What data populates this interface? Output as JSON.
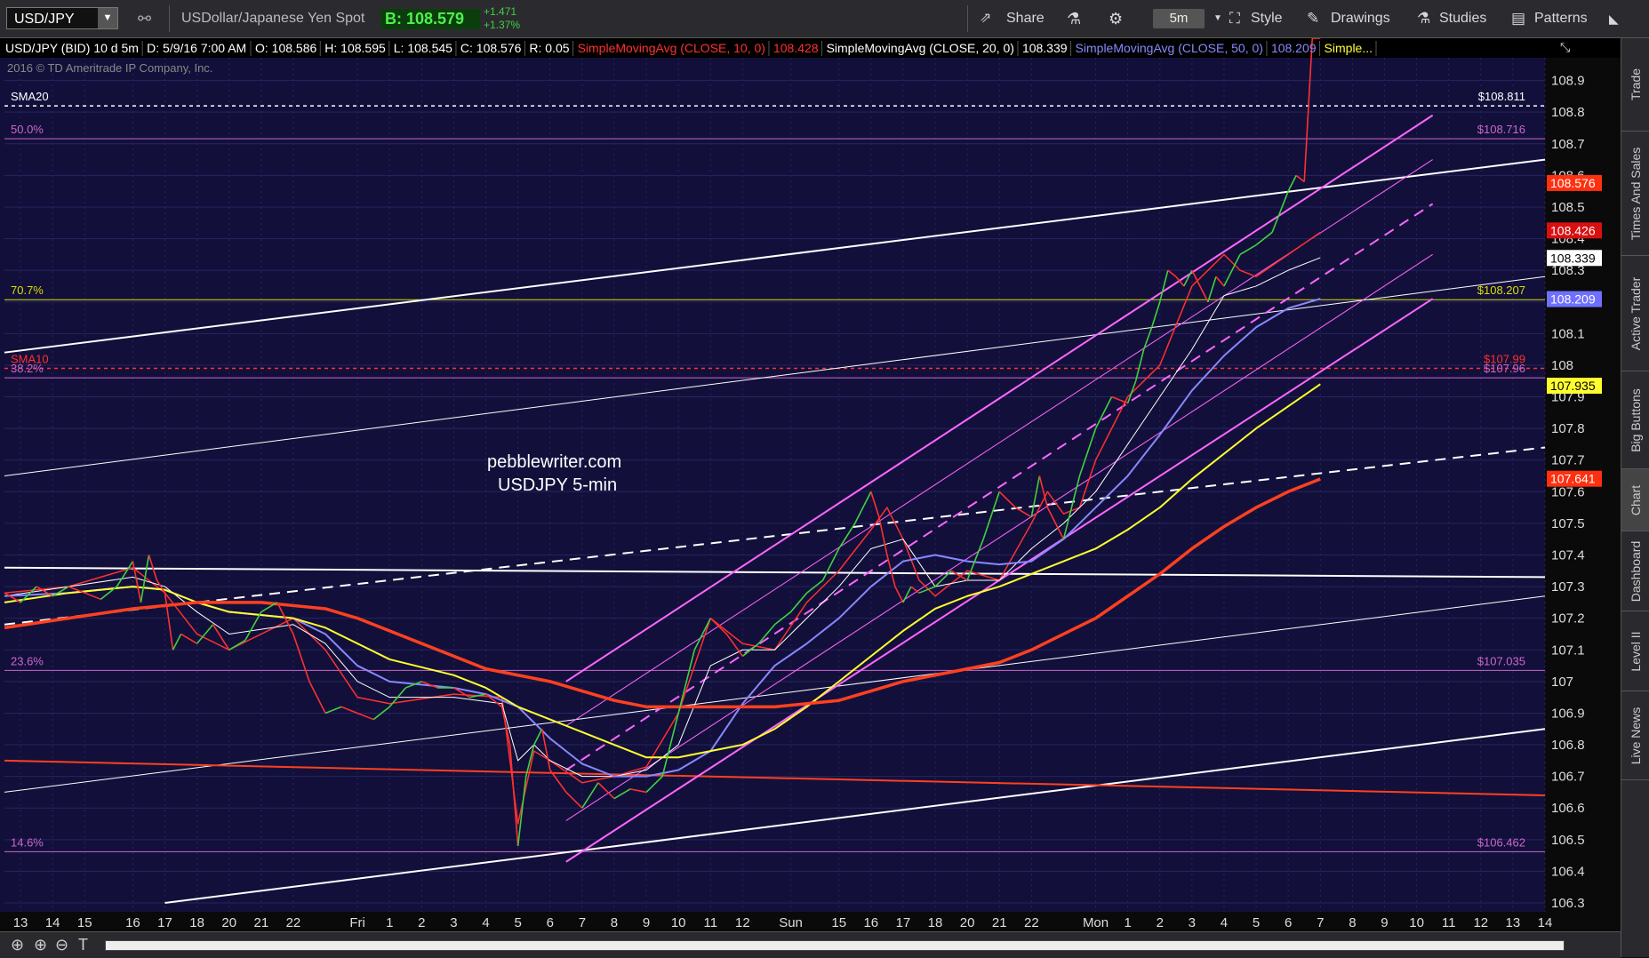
{
  "toolbar": {
    "symbol": "USD/JPY",
    "description": "USDollar/Japanese Yen Spot",
    "bid": "B: 108.579",
    "change_abs": "+1.471",
    "change_pct": "+1.37%",
    "share": "Share",
    "timeframe": "5m",
    "style": "Style",
    "drawings": "Drawings",
    "studies": "Studies",
    "patterns": "Patterns"
  },
  "sidebar": [
    "Trade",
    "Times And Sales",
    "Active Trader",
    "Big Buttons",
    "Chart",
    "Dashboard",
    "Level II",
    "Live News"
  ],
  "chart_data": {
    "type": "line",
    "header": [
      {
        "text": "USD/JPY (BID) 10 d 5m",
        "color": "#ffffff"
      },
      {
        "text": "D: 5/9/16 7:00 AM",
        "color": "#ffffff"
      },
      {
        "text": "O: 108.586",
        "color": "#ffffff"
      },
      {
        "text": "H: 108.595",
        "color": "#ffffff"
      },
      {
        "text": "L: 108.545",
        "color": "#ffffff"
      },
      {
        "text": "C: 108.576",
        "color": "#ffffff"
      },
      {
        "text": "R: 0.05",
        "color": "#ffffff"
      },
      {
        "text": "SimpleMovingAvg (CLOSE, 10, 0)",
        "color": "#ff3030"
      },
      {
        "text": "108.428",
        "color": "#ff3030"
      },
      {
        "text": "SimpleMovingAvg (CLOSE, 20, 0)",
        "color": "#ffffff"
      },
      {
        "text": "108.339",
        "color": "#ffffff"
      },
      {
        "text": "SimpleMovingAvg (CLOSE, 50, 0)",
        "color": "#8888ff"
      },
      {
        "text": "108.209",
        "color": "#8888ff"
      },
      {
        "text": "Simple...",
        "color": "#ffff40"
      }
    ],
    "copyright": "2016 © TD Ameritrade IP Company, Inc.",
    "watermark": [
      "pebblewriter.com",
      "USDJPY 5-min"
    ],
    "ylim": [
      106.3,
      109.0
    ],
    "yticks": [
      106.3,
      106.4,
      106.5,
      106.6,
      106.7,
      106.8,
      106.9,
      107,
      107.1,
      107.2,
      107.3,
      107.4,
      107.5,
      107.6,
      107.7,
      107.8,
      107.9,
      108,
      108.1,
      108.2,
      108.3,
      108.4,
      108.5,
      108.6,
      108.7,
      108.8,
      108.9
    ],
    "xlim": [
      0,
      96
    ],
    "xticks": [
      {
        "x": 1,
        "label": "13"
      },
      {
        "x": 3,
        "label": "14"
      },
      {
        "x": 5,
        "label": "15"
      },
      {
        "x": 8,
        "label": "16"
      },
      {
        "x": 10,
        "label": "17"
      },
      {
        "x": 12,
        "label": "18"
      },
      {
        "x": 14,
        "label": "20"
      },
      {
        "x": 16,
        "label": "21"
      },
      {
        "x": 18,
        "label": "22"
      },
      {
        "x": 22,
        "label": "Fri"
      },
      {
        "x": 24,
        "label": "1"
      },
      {
        "x": 26,
        "label": "2"
      },
      {
        "x": 28,
        "label": "3"
      },
      {
        "x": 30,
        "label": "4"
      },
      {
        "x": 32,
        "label": "5"
      },
      {
        "x": 34,
        "label": "6"
      },
      {
        "x": 36,
        "label": "7"
      },
      {
        "x": 38,
        "label": "8"
      },
      {
        "x": 40,
        "label": "9"
      },
      {
        "x": 42,
        "label": "10"
      },
      {
        "x": 44,
        "label": "11"
      },
      {
        "x": 46,
        "label": "12"
      },
      {
        "x": 49,
        "label": "Sun"
      },
      {
        "x": 52,
        "label": "15"
      },
      {
        "x": 54,
        "label": "16"
      },
      {
        "x": 56,
        "label": "17"
      },
      {
        "x": 58,
        "label": "18"
      },
      {
        "x": 60,
        "label": "20"
      },
      {
        "x": 62,
        "label": "21"
      },
      {
        "x": 64,
        "label": "22"
      },
      {
        "x": 68,
        "label": "Mon"
      },
      {
        "x": 70,
        "label": "1"
      },
      {
        "x": 72,
        "label": "2"
      },
      {
        "x": 74,
        "label": "3"
      },
      {
        "x": 76,
        "label": "4"
      },
      {
        "x": 78,
        "label": "5"
      },
      {
        "x": 80,
        "label": "6"
      },
      {
        "x": 82,
        "label": "7"
      },
      {
        "x": 84,
        "label": "8"
      },
      {
        "x": 86,
        "label": "9"
      },
      {
        "x": 88,
        "label": "10"
      },
      {
        "x": 90,
        "label": "11"
      },
      {
        "x": 92,
        "label": "12"
      },
      {
        "x": 94,
        "label": "13"
      },
      {
        "x": 96,
        "label": "14"
      }
    ],
    "levels": [
      {
        "name": "SMA20",
        "y": 108.82,
        "color": "#ffffff",
        "dash": true,
        "left": "SMA20",
        "right": "$108.811"
      },
      {
        "name": "fib-50",
        "y": 108.716,
        "color": "#cc66cc",
        "dash": false,
        "left": "50.0%",
        "right": "$108.716"
      },
      {
        "name": "fib-70.7",
        "y": 108.207,
        "color": "#dddd00",
        "dash": false,
        "left": "70.7%",
        "right": "$108.207"
      },
      {
        "name": "SMA10",
        "y": 107.99,
        "color": "#ff3030",
        "dash": true,
        "left": "SMA10",
        "right": "$107.99"
      },
      {
        "name": "fib-38.2",
        "y": 107.96,
        "color": "#cc66cc",
        "dash": false,
        "left": "38.2%",
        "right": "$107.96"
      },
      {
        "name": "fib-23.6",
        "y": 107.035,
        "color": "#cc66cc",
        "dash": false,
        "left": "23.6%",
        "right": "$107.035"
      },
      {
        "name": "fib-14.6",
        "y": 106.462,
        "color": "#cc66cc",
        "dash": false,
        "left": "14.6%",
        "right": "$106.462"
      }
    ],
    "trendlines": [
      {
        "x1": 0,
        "y1": 108.04,
        "x2": 96,
        "y2": 108.65,
        "color": "#ffffff",
        "width": 2,
        "dash": false
      },
      {
        "x1": 0,
        "y1": 107.65,
        "x2": 96,
        "y2": 108.28,
        "color": "#ffffff",
        "width": 1,
        "dash": false
      },
      {
        "x1": 0,
        "y1": 107.36,
        "x2": 96,
        "y2": 107.33,
        "color": "#ffffff",
        "width": 2,
        "dash": false
      },
      {
        "x1": 0,
        "y1": 107.18,
        "x2": 96,
        "y2": 107.74,
        "color": "#ffffff",
        "width": 2,
        "dash": true
      },
      {
        "x1": 0,
        "y1": 106.65,
        "x2": 96,
        "y2": 107.27,
        "color": "#ffffff",
        "width": 1,
        "dash": false
      },
      {
        "x1": 10,
        "y1": 106.3,
        "x2": 96,
        "y2": 106.85,
        "color": "#ffffff",
        "width": 2,
        "dash": false
      },
      {
        "x1": 0,
        "y1": 106.75,
        "x2": 96,
        "y2": 106.64,
        "color": "#ff4020",
        "width": 2,
        "dash": false
      },
      {
        "x1": 35,
        "y1": 107.0,
        "x2": 89,
        "y2": 108.79,
        "color": "#ff66ff",
        "width": 2,
        "dash": false
      },
      {
        "x1": 35,
        "y1": 106.43,
        "x2": 89,
        "y2": 108.21,
        "color": "#ff66ff",
        "width": 2,
        "dash": false
      },
      {
        "x1": 35,
        "y1": 106.72,
        "x2": 89,
        "y2": 108.51,
        "color": "#ff66ff",
        "width": 2,
        "dash": true
      },
      {
        "x1": 35,
        "y1": 106.86,
        "x2": 89,
        "y2": 108.65,
        "color": "#ff66ff",
        "width": 1,
        "dash": false
      },
      {
        "x1": 35,
        "y1": 106.56,
        "x2": 89,
        "y2": 108.35,
        "color": "#ff66ff",
        "width": 1,
        "dash": false
      }
    ],
    "price_labels": [
      {
        "value": 108.576,
        "text": "108.576",
        "bg": "#ff3010",
        "fg": "#ffffff"
      },
      {
        "value": 108.426,
        "text": "108.426",
        "bg": "#d81010",
        "fg": "#ffffff"
      },
      {
        "value": 108.339,
        "text": "108.339",
        "bg": "#ffffff",
        "fg": "#000000"
      },
      {
        "value": 108.209,
        "text": "108.209",
        "bg": "#7070ff",
        "fg": "#ffffff"
      },
      {
        "value": 107.935,
        "text": "107.935",
        "bg": "#ffff30",
        "fg": "#000000"
      },
      {
        "value": 107.641,
        "text": "107.641",
        "bg": "#ff3010",
        "fg": "#ffffff"
      }
    ],
    "series": [
      {
        "name": "SimpleMovingAvg (CLOSE, 10, 0)",
        "color": "#ff3030",
        "width": 1.5,
        "x": [
          0,
          4,
          8,
          10,
          12,
          14,
          18,
          20,
          22,
          24,
          28,
          31,
          32,
          33,
          34,
          36,
          38,
          40,
          42,
          44,
          46,
          48,
          50,
          52,
          54,
          55,
          56,
          57,
          58,
          60,
          62,
          64,
          65,
          66,
          67,
          68,
          70,
          72,
          74,
          76,
          77,
          78,
          80,
          82
        ],
        "values": [
          107.28,
          107.3,
          107.36,
          107.28,
          107.15,
          107.1,
          107.2,
          107.1,
          106.95,
          106.93,
          106.96,
          106.95,
          106.55,
          106.78,
          106.75,
          106.68,
          106.7,
          106.73,
          106.9,
          107.2,
          107.12,
          107.1,
          107.25,
          107.35,
          107.48,
          107.55,
          107.45,
          107.32,
          107.27,
          107.35,
          107.32,
          107.5,
          107.6,
          107.53,
          107.55,
          107.7,
          107.9,
          108.0,
          108.25,
          108.35,
          108.3,
          108.28,
          108.35,
          108.42
        ]
      },
      {
        "name": "SimpleMovingAvg (CLOSE, 20, 0)",
        "color": "#ffffff",
        "width": 1,
        "x": [
          0,
          4,
          8,
          10,
          12,
          14,
          18,
          20,
          22,
          24,
          28,
          31,
          32,
          33,
          34,
          36,
          38,
          40,
          42,
          44,
          46,
          48,
          50,
          52,
          54,
          56,
          58,
          60,
          62,
          64,
          66,
          68,
          70,
          72,
          74,
          76,
          78,
          80,
          82
        ],
        "values": [
          107.27,
          107.3,
          107.33,
          107.3,
          107.22,
          107.15,
          107.18,
          107.12,
          107.0,
          106.95,
          106.95,
          106.93,
          106.75,
          106.8,
          106.75,
          106.7,
          106.7,
          106.72,
          106.8,
          107.05,
          107.1,
          107.1,
          107.2,
          107.3,
          107.42,
          107.45,
          107.3,
          107.32,
          107.32,
          107.42,
          107.5,
          107.6,
          107.75,
          107.9,
          108.05,
          108.22,
          108.25,
          108.3,
          108.34
        ]
      },
      {
        "name": "SimpleMovingAvg (CLOSE, 50, 0)",
        "color": "#8888ff",
        "width": 2,
        "x": [
          0,
          4,
          8,
          10,
          12,
          14,
          18,
          20,
          22,
          24,
          28,
          30,
          32,
          34,
          36,
          38,
          40,
          42,
          44,
          46,
          48,
          50,
          52,
          54,
          56,
          58,
          60,
          62,
          64,
          66,
          68,
          70,
          72,
          74,
          76,
          78,
          80,
          82
        ],
        "values": [
          107.27,
          107.28,
          107.3,
          107.29,
          107.25,
          107.22,
          107.2,
          107.15,
          107.05,
          107.0,
          106.98,
          106.96,
          106.92,
          106.82,
          106.74,
          106.7,
          106.7,
          106.72,
          106.78,
          106.93,
          107.05,
          107.12,
          107.2,
          107.3,
          107.38,
          107.4,
          107.38,
          107.37,
          107.38,
          107.45,
          107.55,
          107.65,
          107.78,
          107.92,
          108.03,
          108.12,
          108.18,
          108.21
        ]
      },
      {
        "name": "Simple...",
        "color": "#ffff30",
        "width": 2,
        "x": [
          0,
          4,
          8,
          10,
          12,
          14,
          18,
          20,
          22,
          24,
          28,
          30,
          32,
          34,
          36,
          38,
          40,
          42,
          44,
          46,
          48,
          50,
          52,
          54,
          56,
          58,
          60,
          62,
          64,
          66,
          68,
          70,
          72,
          74,
          76,
          78,
          80,
          82
        ],
        "values": [
          107.25,
          107.28,
          107.3,
          107.29,
          107.25,
          107.22,
          107.2,
          107.17,
          107.12,
          107.07,
          107.02,
          106.98,
          106.92,
          106.88,
          106.84,
          106.8,
          106.76,
          106.76,
          106.78,
          106.8,
          106.85,
          106.92,
          107.0,
          107.08,
          107.16,
          107.23,
          107.27,
          107.3,
          107.34,
          107.38,
          107.42,
          107.48,
          107.55,
          107.64,
          107.72,
          107.8,
          107.87,
          107.94
        ]
      },
      {
        "name": "SMA 200",
        "color": "#ff4020",
        "width": 3.5,
        "x": [
          0,
          4,
          8,
          10,
          12,
          14,
          16,
          18,
          20,
          22,
          24,
          26,
          28,
          30,
          32,
          34,
          36,
          38,
          40,
          42,
          44,
          46,
          48,
          50,
          52,
          54,
          56,
          58,
          60,
          62,
          64,
          66,
          68,
          70,
          72,
          74,
          76,
          78,
          80,
          82
        ],
        "values": [
          107.17,
          107.2,
          107.23,
          107.24,
          107.25,
          107.25,
          107.25,
          107.24,
          107.23,
          107.2,
          107.16,
          107.12,
          107.08,
          107.04,
          107.02,
          107.0,
          106.97,
          106.94,
          106.92,
          106.92,
          106.92,
          106.92,
          106.92,
          106.93,
          106.94,
          106.97,
          107.0,
          107.02,
          107.04,
          107.06,
          107.1,
          107.15,
          107.2,
          107.27,
          107.34,
          107.42,
          107.49,
          107.55,
          107.6,
          107.64
        ]
      }
    ],
    "price": {
      "name": "USD/JPY",
      "color": "#40d040",
      "downcolor": "#ff3030",
      "x": [
        0,
        1,
        2,
        3,
        4,
        5,
        6,
        7,
        8,
        8.5,
        9,
        9.5,
        10,
        10.5,
        11,
        12,
        13,
        14,
        15,
        16,
        17,
        18,
        19,
        20,
        21,
        22,
        23,
        24,
        25,
        26,
        27,
        28,
        29,
        30,
        31,
        31.5,
        32,
        32.5,
        33,
        33.5,
        34,
        35,
        36,
        37,
        38,
        39,
        40,
        41,
        42,
        43,
        44,
        45,
        46,
        47,
        48,
        49,
        50,
        51,
        52,
        53,
        54,
        54.5,
        55,
        55.5,
        56,
        56.5,
        57,
        58,
        59,
        60,
        61,
        62,
        63,
        64,
        64.5,
        65,
        65.5,
        66,
        66.5,
        67,
        68,
        69,
        70,
        70.5,
        71,
        71.5,
        72,
        72.5,
        73,
        73.5,
        74,
        75,
        75.5,
        76,
        76.5,
        77,
        78,
        79,
        80,
        80.5,
        81,
        81.5,
        82
      ],
      "values": [
        107.28,
        107.25,
        107.3,
        107.27,
        107.3,
        107.28,
        107.26,
        107.3,
        107.38,
        107.25,
        107.4,
        107.32,
        107.28,
        107.1,
        107.15,
        107.12,
        107.18,
        107.1,
        107.13,
        107.22,
        107.25,
        107.15,
        107.0,
        106.9,
        106.92,
        106.9,
        106.88,
        106.92,
        106.98,
        107.0,
        106.98,
        106.98,
        106.95,
        106.96,
        106.92,
        106.8,
        106.48,
        106.7,
        106.8,
        106.85,
        106.72,
        106.65,
        106.6,
        106.68,
        106.63,
        106.66,
        106.65,
        106.7,
        106.9,
        107.1,
        107.2,
        107.15,
        107.08,
        107.12,
        107.18,
        107.22,
        107.28,
        107.32,
        107.42,
        107.5,
        107.6,
        107.52,
        107.4,
        107.3,
        107.25,
        107.3,
        107.28,
        107.3,
        107.35,
        107.32,
        107.45,
        107.6,
        107.55,
        107.52,
        107.65,
        107.55,
        107.5,
        107.45,
        107.55,
        107.65,
        107.8,
        107.9,
        107.88,
        107.95,
        108.05,
        108.12,
        108.2,
        108.3,
        108.28,
        108.25,
        108.3,
        108.2,
        108.28,
        108.25,
        108.3,
        108.35,
        108.38,
        108.42,
        108.55,
        108.6,
        108.58
      ]
    }
  }
}
